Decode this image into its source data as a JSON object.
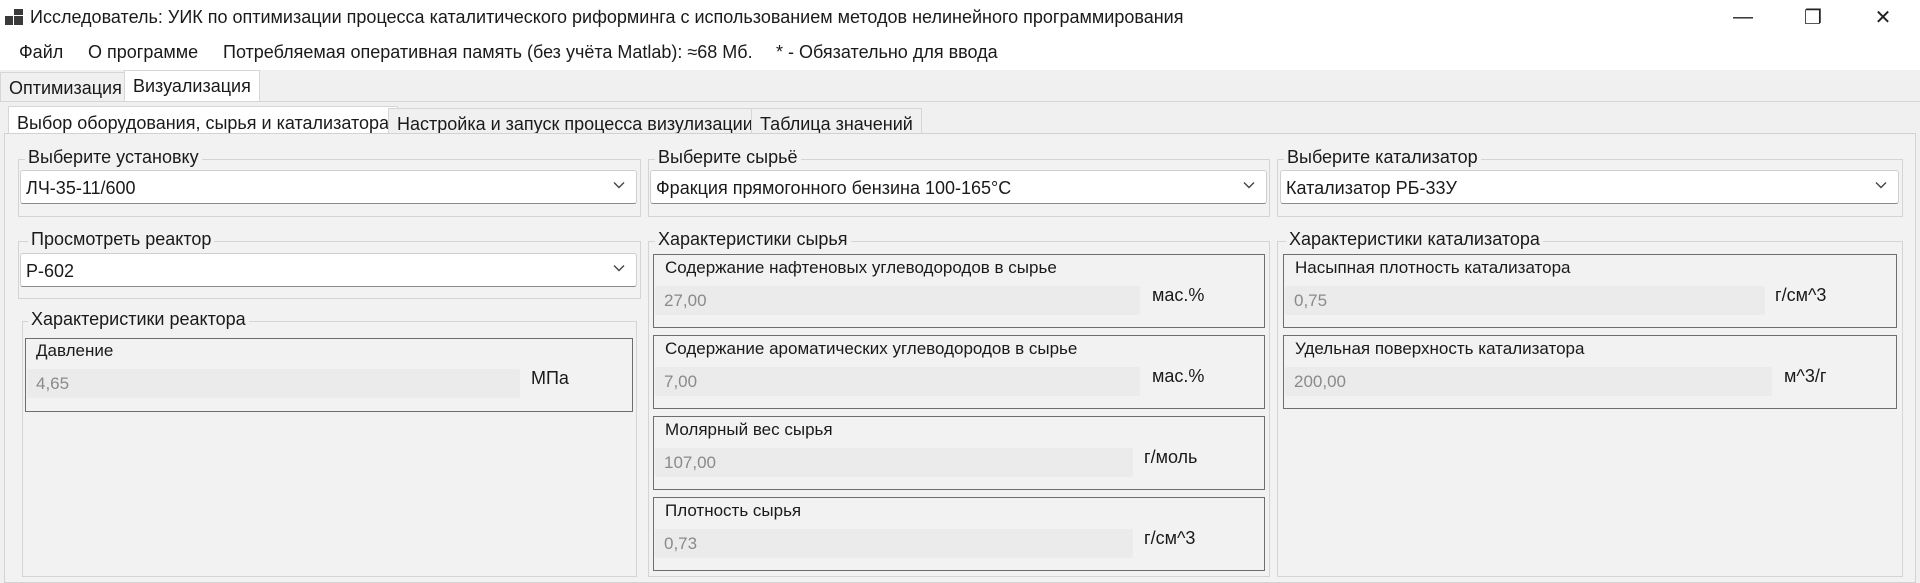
{
  "window": {
    "title": "Исследователь: УИК по оптимизации процесса каталитического риформинга с использованием методов нелинейного программирования",
    "minimize_glyph": "—",
    "maximize_glyph": "❐",
    "close_glyph": "✕"
  },
  "menu": {
    "file": "Файл",
    "about": "О программе",
    "memory": "Потребляемая оперативная память (без учёта Matlab): ≈68 Мб.",
    "required_note": "* - Обязательно для ввода"
  },
  "main_tabs": [
    "Оптимизация",
    "Визуализация"
  ],
  "sub_tabs": [
    "Выбор оборудования, сырья и катализатора",
    "Настройка и запуск процесса визулизации",
    "Таблица значений"
  ],
  "selects": {
    "unit": {
      "label": "Выберите установку",
      "value": "ЛЧ-35-11/600"
    },
    "feedstock": {
      "label": "Выберите сырьё",
      "value": "Фракция прямогонного бензина 100-165°С"
    },
    "catalyst": {
      "label": "Выберите катализатор",
      "value": "Катализатор РБ-33У"
    },
    "reactor": {
      "label": "Просмотреть реактор",
      "value": "Р-602"
    }
  },
  "reactor_chars": {
    "title": "Характеристики реактора",
    "pressure": {
      "label": "Давление",
      "value": "4,65",
      "unit": "МПа"
    }
  },
  "feed_chars": {
    "title": "Характеристики сырья",
    "naphthenes": {
      "label": "Содержание нафтеновых углеводородов в сырье",
      "value": "27,00",
      "unit": "мас.%"
    },
    "aromatics": {
      "label": "Содержание ароматических углеводородов в сырье",
      "value": "7,00",
      "unit": "мас.%"
    },
    "molar_weight": {
      "label": "Молярный вес сырья",
      "value": "107,00",
      "unit": "г/моль"
    },
    "density": {
      "label": "Плотность сырья",
      "value": "0,73",
      "unit": "г/см^3"
    }
  },
  "catalyst_chars": {
    "title": "Характеристики катализатора",
    "bulk_density": {
      "label": "Насыпная плотность катализатора",
      "value": "0,75",
      "unit": "г/см^3"
    },
    "surface": {
      "label": "Удельная поверхность катализатора",
      "value": "200,00",
      "unit": "м^3/г"
    }
  },
  "icons": {
    "app": "app-icon",
    "dropdown": "chevron-down-icon"
  },
  "colors": {
    "window_bg": "#f0f0f0",
    "titlebar_bg": "#ffffff",
    "disabled_text": "#8a8a8a"
  }
}
